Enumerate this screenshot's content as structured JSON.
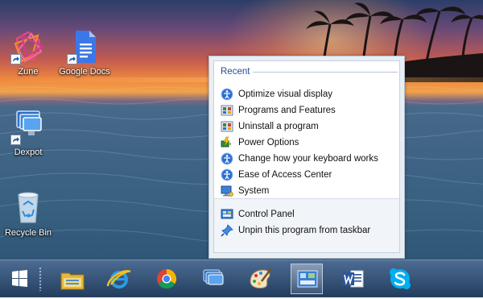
{
  "desktop": {
    "icons": [
      {
        "label": "Zune"
      },
      {
        "label": "Google Docs"
      },
      {
        "label": "Dexpot"
      },
      {
        "label": "Recycle Bin"
      }
    ]
  },
  "jumplist": {
    "recent_header": "Recent",
    "recent": [
      {
        "label": "Optimize visual display",
        "icon": "ease-of-access-icon"
      },
      {
        "label": "Programs and Features",
        "icon": "programs-features-icon"
      },
      {
        "label": "Uninstall a program",
        "icon": "programs-features-icon"
      },
      {
        "label": "Power Options",
        "icon": "power-options-icon"
      },
      {
        "label": "Change how your keyboard works",
        "icon": "ease-of-access-icon"
      },
      {
        "label": "Ease of Access Center",
        "icon": "ease-of-access-icon"
      },
      {
        "label": "System",
        "icon": "system-icon"
      }
    ],
    "tasks": [
      {
        "label": "Control Panel",
        "icon": "control-panel-icon"
      },
      {
        "label": "Unpin this program from taskbar",
        "icon": "unpin-icon"
      }
    ]
  },
  "taskbar": {
    "buttons": [
      "windows-start-icon",
      "file-explorer-icon",
      "internet-explorer-icon",
      "chrome-icon",
      "dexpot-icon",
      "paint-icon",
      "control-panel-icon",
      "word-icon",
      "skype-icon"
    ],
    "active": "control-panel-icon"
  }
}
